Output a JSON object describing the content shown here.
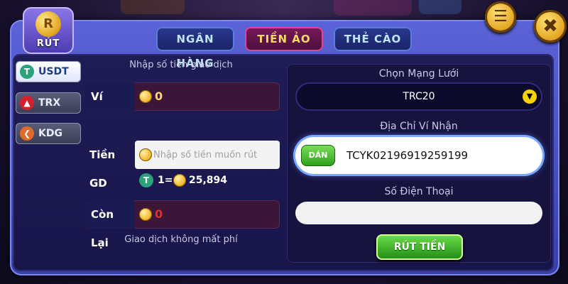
{
  "header": {
    "logo_text": "RÚT",
    "tabs": [
      {
        "label": "NGÂN HÀNG",
        "active": false
      },
      {
        "label": "TIỀN ẢO",
        "active": true
      },
      {
        "label": "THẺ CÀO",
        "active": false
      }
    ]
  },
  "coins": [
    {
      "label": "USDT",
      "icon": "usdt-icon",
      "color": "#2aa37a",
      "active": true
    },
    {
      "label": "TRX",
      "icon": "trx-icon",
      "color": "#d3202d",
      "active": false
    },
    {
      "label": "KDG",
      "icon": "kdg-icon",
      "color": "#e06a2a",
      "active": false
    }
  ],
  "left_form": {
    "title": "Nhập số tiền giao dịch",
    "wallet_label": "Ví",
    "wallet_value": "0",
    "amount_label": "Tiền GD",
    "amount_placeholder": "Nhập số tiền muốn rút",
    "rate_left": "1=",
    "rate_right": "25,894",
    "remaining_label": "Còn Lại",
    "remaining_value": "0",
    "fee_note": "Giao dịch không mất phí"
  },
  "right_form": {
    "network_label": "Chọn Mạng Lưới",
    "network_value": "TRC20",
    "address_label": "Địa Chỉ Ví Nhận",
    "paste_label": "DÁN",
    "address_value": "TCYK02196919259199",
    "phone_label": "Số Điện Thoại",
    "phone_value": "",
    "submit_label": "RÚT TIỀN"
  },
  "colors": {
    "accent": "#ffd86b",
    "tab_active_border": "#e0469b",
    "green_button": "#2e9e1a",
    "zero_value": "#e0302a"
  }
}
